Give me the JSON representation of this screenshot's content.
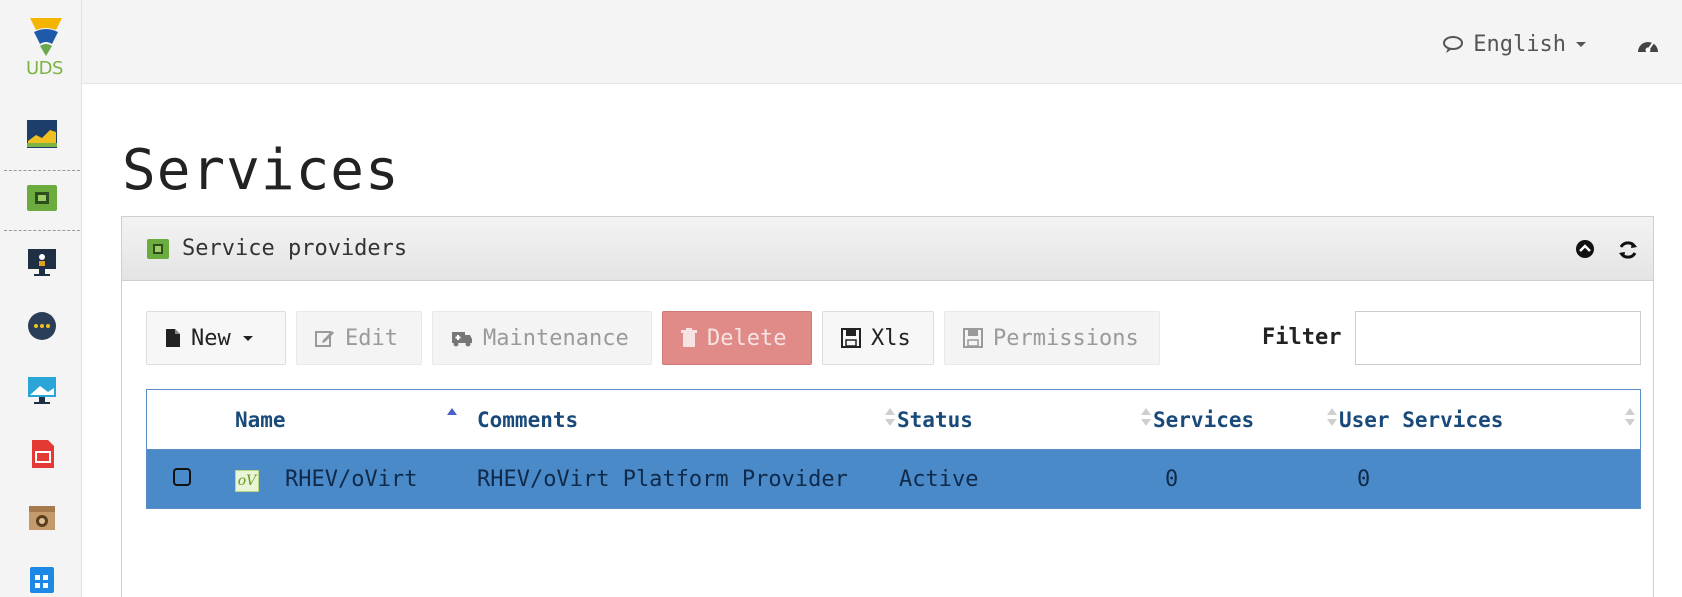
{
  "app": {
    "logo_text": "UDS"
  },
  "topbar": {
    "language": "English"
  },
  "sidebar": {
    "items": [
      {
        "icon": "dashboard-chart-icon"
      },
      {
        "icon": "service-providers-icon"
      },
      {
        "icon": "authenticators-icon"
      },
      {
        "icon": "os-managers-icon"
      },
      {
        "icon": "connectivity-icon"
      },
      {
        "icon": "reports-icon"
      },
      {
        "icon": "gallery-icon"
      },
      {
        "icon": "calendar-icon"
      }
    ]
  },
  "page": {
    "title": "Services"
  },
  "panel": {
    "title": "Service providers"
  },
  "toolbar": {
    "new_label": "New",
    "edit_label": "Edit",
    "maintenance_label": "Maintenance",
    "delete_label": "Delete",
    "xls_label": "Xls",
    "permissions_label": "Permissions",
    "filter_label": "Filter",
    "filter_value": ""
  },
  "table": {
    "columns": [
      {
        "label": "Name",
        "sort": "asc"
      },
      {
        "label": "Comments",
        "sort": "none"
      },
      {
        "label": "Status",
        "sort": "none"
      },
      {
        "label": "Services",
        "sort": "none"
      },
      {
        "label": "User Services",
        "sort": "none"
      }
    ],
    "rows": [
      {
        "name": "RHEV/oVirt",
        "comments": "RHEV/oVirt Platform Provider",
        "status": "Active",
        "services": "0",
        "user_services": "0",
        "selected": true
      }
    ]
  },
  "colors": {
    "selected_row": "#4a8ac8",
    "delete_button": "#e08b88",
    "header_text": "#1a4a7a"
  }
}
